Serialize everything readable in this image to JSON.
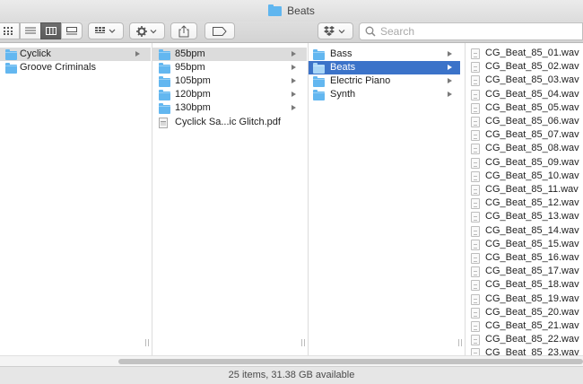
{
  "window": {
    "title": "Beats",
    "status": "25 items, 31.38 GB available"
  },
  "toolbar": {
    "view_buttons": [
      {
        "name": "icon-view-button",
        "icon": "icon-grid-icon",
        "selected": false
      },
      {
        "name": "list-view-button",
        "icon": "list-icon",
        "selected": false
      },
      {
        "name": "column-view-button",
        "icon": "columns-icon",
        "selected": true
      },
      {
        "name": "gallery-view-button",
        "icon": "gallery-icon",
        "selected": false
      }
    ],
    "search_placeholder": "Search"
  },
  "columns": [
    {
      "items": [
        {
          "label": "Cyclick",
          "type": "folder",
          "has_children": true,
          "selected": "gray"
        },
        {
          "label": "Groove Criminals",
          "type": "folder",
          "has_children": false,
          "selected": null
        }
      ]
    },
    {
      "items": [
        {
          "label": "85bpm",
          "type": "folder",
          "has_children": true,
          "selected": "gray"
        },
        {
          "label": "95bpm",
          "type": "folder",
          "has_children": true,
          "selected": null
        },
        {
          "label": "105bpm",
          "type": "folder",
          "has_children": true,
          "selected": null
        },
        {
          "label": "120bpm",
          "type": "folder",
          "has_children": true,
          "selected": null
        },
        {
          "label": "130bpm",
          "type": "folder",
          "has_children": true,
          "selected": null
        },
        {
          "label": "Cyclick Sa...ic Glitch.pdf",
          "type": "pdf",
          "has_children": false,
          "selected": null
        }
      ]
    },
    {
      "items": [
        {
          "label": "Bass",
          "type": "folder",
          "has_children": true,
          "selected": null
        },
        {
          "label": "Beats",
          "type": "folder",
          "has_children": true,
          "selected": "blue"
        },
        {
          "label": "Electric Piano",
          "type": "folder",
          "has_children": true,
          "selected": null
        },
        {
          "label": "Synth",
          "type": "folder",
          "has_children": true,
          "selected": null
        }
      ]
    },
    {
      "items": [
        {
          "label": "CG_Beat_85_01.wav",
          "type": "wav"
        },
        {
          "label": "CG_Beat_85_02.wav",
          "type": "wav"
        },
        {
          "label": "CG_Beat_85_03.wav",
          "type": "wav"
        },
        {
          "label": "CG_Beat_85_04.wav",
          "type": "wav"
        },
        {
          "label": "CG_Beat_85_05.wav",
          "type": "wav"
        },
        {
          "label": "CG_Beat_85_06.wav",
          "type": "wav"
        },
        {
          "label": "CG_Beat_85_07.wav",
          "type": "wav"
        },
        {
          "label": "CG_Beat_85_08.wav",
          "type": "wav"
        },
        {
          "label": "CG_Beat_85_09.wav",
          "type": "wav"
        },
        {
          "label": "CG_Beat_85_10.wav",
          "type": "wav"
        },
        {
          "label": "CG_Beat_85_11.wav",
          "type": "wav"
        },
        {
          "label": "CG_Beat_85_12.wav",
          "type": "wav"
        },
        {
          "label": "CG_Beat_85_13.wav",
          "type": "wav"
        },
        {
          "label": "CG_Beat_85_14.wav",
          "type": "wav"
        },
        {
          "label": "CG_Beat_85_15.wav",
          "type": "wav"
        },
        {
          "label": "CG_Beat_85_16.wav",
          "type": "wav"
        },
        {
          "label": "CG_Beat_85_17.wav",
          "type": "wav"
        },
        {
          "label": "CG_Beat_85_18.wav",
          "type": "wav"
        },
        {
          "label": "CG_Beat_85_19.wav",
          "type": "wav"
        },
        {
          "label": "CG_Beat_85_20.wav",
          "type": "wav"
        },
        {
          "label": "CG_Beat_85_21.wav",
          "type": "wav"
        },
        {
          "label": "CG_Beat_85_22.wav",
          "type": "wav"
        },
        {
          "label": "CG_Beat_85_23.wav",
          "type": "wav"
        }
      ]
    }
  ],
  "colors": {
    "selection_blue": "#3b73c9",
    "folder_blue": "#63b7f0"
  }
}
